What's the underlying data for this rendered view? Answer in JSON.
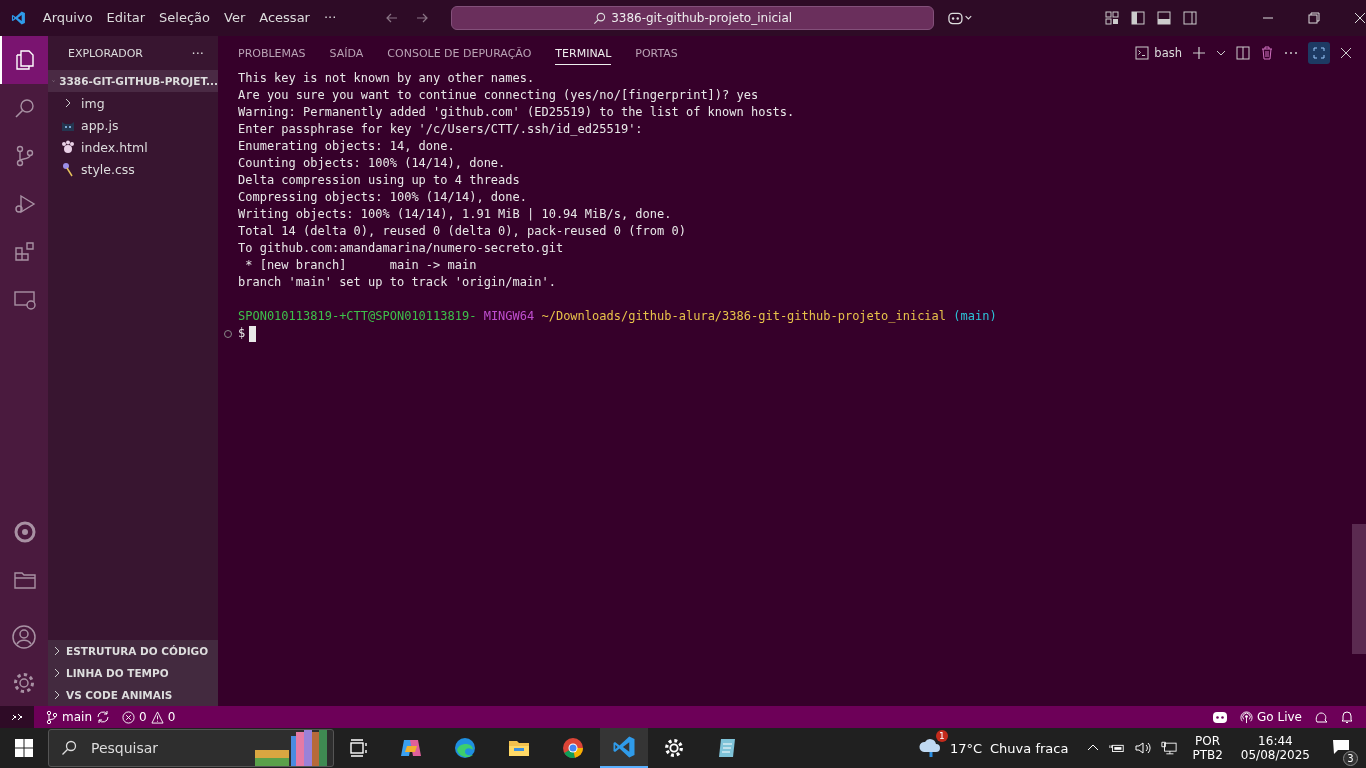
{
  "title_bar": {
    "menu": [
      "Arquivo",
      "Editar",
      "Seleção",
      "Ver",
      "Acessar",
      "···"
    ],
    "command_center": "3386-git-github-projeto_inicial"
  },
  "activity_bar": {
    "items": [
      {
        "kind": "files",
        "selected": true
      },
      {
        "kind": "search",
        "selected": false
      },
      {
        "kind": "git",
        "selected": false
      },
      {
        "kind": "debug",
        "selected": false
      },
      {
        "kind": "extensions",
        "selected": false
      },
      {
        "kind": "remote",
        "selected": false
      },
      {
        "kind": "circle",
        "selected": false
      },
      {
        "kind": "folder",
        "selected": false
      }
    ]
  },
  "sidebar": {
    "title": "EXPLORADOR",
    "more": "···",
    "folder": {
      "label": "3386-GIT-GITHUB-PROJET...",
      "expanded": true
    },
    "files": [
      {
        "label": "img",
        "kind": "folder"
      },
      {
        "label": "app.js",
        "kind": "js"
      },
      {
        "label": "index.html",
        "kind": "html"
      },
      {
        "label": "style.css",
        "kind": "css"
      }
    ],
    "sections": [
      {
        "label": "ESTRUTURA DO CÓDIGO",
        "expanded": false
      },
      {
        "label": "LINHA DO TEMPO",
        "expanded": false
      },
      {
        "label": "VS CODE ANIMAIS",
        "expanded": false
      }
    ]
  },
  "panel": {
    "tabs": [
      {
        "label": "PROBLEMAS",
        "selected": false
      },
      {
        "label": "SAÍDA",
        "selected": false
      },
      {
        "label": "CONSOLE DE DEPURAÇÃO",
        "selected": false
      },
      {
        "label": "TERMINAL",
        "selected": true
      },
      {
        "label": "PORTAS",
        "selected": false
      }
    ],
    "shell": "bash"
  },
  "terminal": {
    "lines": [
      "This key is not known by any other names.",
      "Are you sure you want to continue connecting (yes/no/[fingerprint])? yes",
      "Warning: Permanently added 'github.com' (ED25519) to the list of known hosts.",
      "Enter passphrase for key '/c/Users/CTT/.ssh/id_ed25519':",
      "Enumerating objects: 14, done.",
      "Counting objects: 100% (14/14), done.",
      "Delta compression using up to 4 threads",
      "Compressing objects: 100% (14/14), done.",
      "Writing objects: 100% (14/14), 1.91 MiB | 10.94 MiB/s, done.",
      "Total 14 (delta 0), reused 0 (delta 0), pack-reused 0 (from 0)",
      "To github.com:amandamarina/numero-secreto.git",
      " * [new branch]      main -> main",
      "branch 'main' set up to track 'origin/main'."
    ],
    "prompt": {
      "user": "SPON010113819-+CTT@SPON010113819-",
      "shell": "MINGW64",
      "path": "~/Downloads/github-alura/3386-git-github-projeto_inicial",
      "branch": "(main)",
      "symbol": "$"
    }
  },
  "status_bar": {
    "branch": "main",
    "errors": "0",
    "warnings": "0",
    "go_live": "Go Live"
  },
  "taskbar": {
    "search": {
      "placeholder": "Pesquisar"
    },
    "weather": {
      "badge": "1",
      "temperature": "17°C",
      "description": "Chuva fraca"
    },
    "language": "POR",
    "layout": "PTB2",
    "time": "16:44",
    "date": "05/08/2025",
    "notifications": "3"
  }
}
